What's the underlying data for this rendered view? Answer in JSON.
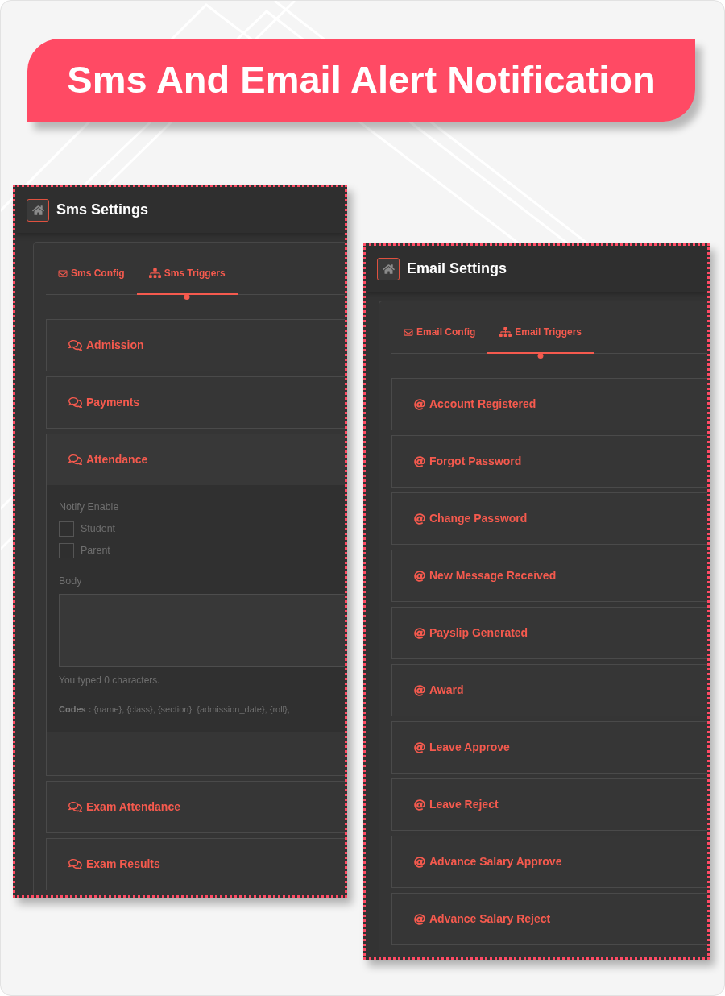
{
  "banner": {
    "title": "Sms And Email Alert Notification"
  },
  "panels": [
    {
      "kind": "sms",
      "title": "Sms Settings",
      "tabs": [
        {
          "label": "Sms Config",
          "selected": false
        },
        {
          "label": "Sms Triggers",
          "selected": true
        }
      ],
      "items": [
        {
          "label": "Admission",
          "expanded": false
        },
        {
          "label": "Payments",
          "expanded": false
        },
        {
          "label": "Attendance",
          "expanded": true,
          "form": {
            "notify_label": "Notify Enable",
            "recipients": [
              {
                "label": "Student",
                "checked": false
              },
              {
                "label": "Parent",
                "checked": false
              }
            ],
            "body_label": "Body",
            "counter": "You typed 0 characters.",
            "codes": "**Codes :** {name}, {class}, {section}, {admission_date}, {roll},"
          }
        },
        {
          "label": "Exam Attendance",
          "expanded": false
        },
        {
          "label": "Exam Results",
          "expanded": false
        }
      ]
    },
    {
      "kind": "email",
      "title": "Email Settings",
      "tabs": [
        {
          "label": "Email Config",
          "selected": false
        },
        {
          "label": "Email Triggers",
          "selected": true
        }
      ],
      "items": [
        {
          "label": "Account Registered",
          "expanded": false
        },
        {
          "label": "Forgot Password",
          "expanded": false
        },
        {
          "label": "Change Password",
          "expanded": false
        },
        {
          "label": "New Message Received",
          "expanded": false
        },
        {
          "label": "Payslip Generated",
          "expanded": false
        },
        {
          "label": "Award",
          "expanded": false
        },
        {
          "label": "Leave Approve",
          "expanded": false
        },
        {
          "label": "Leave Reject",
          "expanded": false
        },
        {
          "label": "Advance Salary Approve",
          "expanded": false
        },
        {
          "label": "Advance Salary Reject",
          "expanded": false
        }
      ]
    }
  ]
}
